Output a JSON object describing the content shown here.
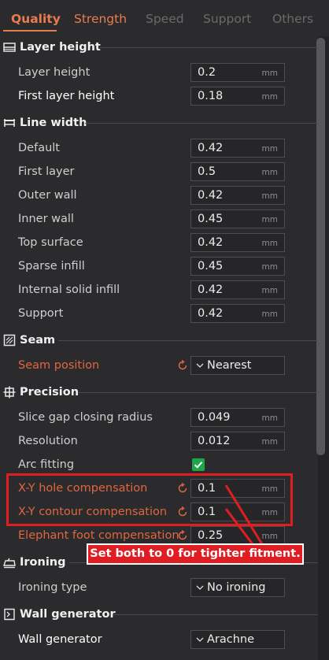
{
  "tabs": [
    {
      "label": "Quality",
      "color": "#e87c4f"
    },
    {
      "label": "Strength",
      "color": "#e87c4f"
    },
    {
      "label": "Speed",
      "color": "#6a6a6a"
    },
    {
      "label": "Support",
      "color": "#6a6a6a"
    },
    {
      "label": "Others",
      "color": "#6a6a6a"
    }
  ],
  "sections": {
    "layer_height": {
      "title": "Layer height",
      "icon": "layer-height-icon"
    },
    "line_width": {
      "title": "Line width",
      "icon": "line-width-icon"
    },
    "seam": {
      "title": "Seam",
      "icon": "seam-icon"
    },
    "precision": {
      "title": "Precision",
      "icon": "precision-icon"
    },
    "ironing": {
      "title": "Ironing",
      "icon": "ironing-icon"
    },
    "wall_generator": {
      "title": "Wall generator",
      "icon": "wall-generator-icon"
    }
  },
  "rows": {
    "layer_height": {
      "label": "Layer height",
      "value": "0.2",
      "unit": "mm"
    },
    "first_layer_height": {
      "label": "First layer height",
      "value": "0.18",
      "unit": "mm"
    },
    "default": {
      "label": "Default",
      "value": "0.42",
      "unit": "mm"
    },
    "first_layer": {
      "label": "First layer",
      "value": "0.5",
      "unit": "mm"
    },
    "outer_wall": {
      "label": "Outer wall",
      "value": "0.42",
      "unit": "mm"
    },
    "inner_wall": {
      "label": "Inner wall",
      "value": "0.45",
      "unit": "mm"
    },
    "top_surface": {
      "label": "Top surface",
      "value": "0.42",
      "unit": "mm"
    },
    "sparse_infill": {
      "label": "Sparse infill",
      "value": "0.45",
      "unit": "mm"
    },
    "internal_solid_infill": {
      "label": "Internal solid infill",
      "value": "0.42",
      "unit": "mm"
    },
    "support": {
      "label": "Support",
      "value": "0.42",
      "unit": "mm"
    },
    "seam_position": {
      "label": "Seam position",
      "value": "Nearest"
    },
    "slice_gap": {
      "label": "Slice gap closing radius",
      "value": "0.049",
      "unit": "mm"
    },
    "resolution": {
      "label": "Resolution",
      "value": "0.012",
      "unit": "mm"
    },
    "arc_fitting": {
      "label": "Arc fitting",
      "checked": true
    },
    "xy_hole": {
      "label": "X-Y hole compensation",
      "value": "0.1",
      "unit": "mm"
    },
    "xy_contour": {
      "label": "X-Y contour compensation",
      "value": "0.1",
      "unit": "mm"
    },
    "elephant_foot": {
      "label": "Elephant foot compensation",
      "value": "0.25",
      "unit": "mm"
    },
    "ironing_type": {
      "label": "Ironing type",
      "value": "No ironing"
    },
    "wall_generator": {
      "label": "Wall generator",
      "value": "Arachne"
    }
  },
  "annotation": {
    "text": "Set both to 0 for tighter fitment.",
    "color": "#e11d24"
  },
  "colors": {
    "accent": "#e87c4f",
    "modified": "#e0663f",
    "checkbox": "#1fa64a",
    "background": "#2b2b2d"
  }
}
